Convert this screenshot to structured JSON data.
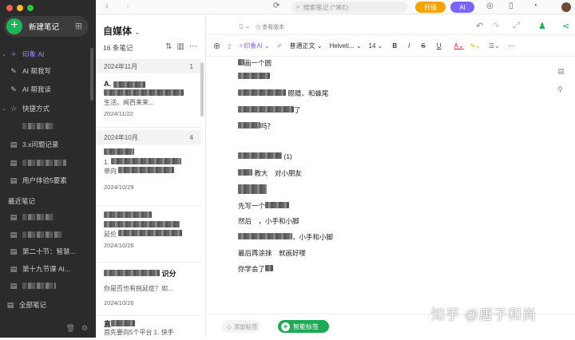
{
  "window": {
    "traffic_colors": [
      "#ff5f57",
      "#febc2e",
      "#28c840"
    ]
  },
  "sidebar": {
    "new_note": "新建笔记",
    "sections": [
      {
        "label": "印象 AI",
        "active": true
      },
      {
        "label": "AI 帮我写"
      },
      {
        "label": "AI 帮我读"
      },
      {
        "label": "快捷方式"
      },
      {
        "label": ""
      },
      {
        "label": "3.x问题记录"
      },
      {
        "label": ""
      },
      {
        "label": "用户体验5要素"
      }
    ],
    "recent_header": "最近笔记",
    "recent": [
      {
        "label": ""
      },
      {
        "label": ""
      },
      {
        "label": "第二十节：智慧..."
      },
      {
        "label": "第十九节课 AI..."
      },
      {
        "label": ""
      }
    ],
    "all_notes": "全部笔记"
  },
  "topbar": {
    "search_placeholder": "搜索笔记 (^⌘E)",
    "upgrade": "升级",
    "ai": "AI"
  },
  "list": {
    "title": "自媒体",
    "count": "16 条笔记",
    "groups": [
      {
        "month": "2024年11月",
        "count": "1"
      },
      {
        "month": "2024年10月",
        "count": "4"
      }
    ],
    "notes": [
      {
        "title": "A.",
        "snippet": "生活。闻西来来...",
        "date": "2024/11/22"
      },
      {
        "title": "",
        "snippet": "1.",
        "snippet2": "单向",
        "date": "2024/10/29"
      },
      {
        "title": "",
        "snippet": "",
        "snippet2": "延伦",
        "date": "2024/10/26"
      },
      {
        "title": "识分",
        "snippet": "你是否也有拖延症？如...",
        "date": "2024/10/26"
      },
      {
        "title": "直",
        "snippet": "首先要向5个平台 1. 快手",
        "date": ""
      }
    ]
  },
  "editor": {
    "toolbar": {
      "doc_label": "",
      "history": "查看版本",
      "ai": "印象AI",
      "style": "普通正文",
      "font": "Helveti...",
      "size": "14"
    },
    "lines": [
      "画一个圆",
      "",
      "眼睛、和蜂尾",
      "了",
      "吗？",
      "",
      "(1)",
      "教大　对小朋友",
      "",
      "先写一个",
      "然后　，小手和小脚",
      "，小手和小脚",
      "最后再涂抹　就画好喽",
      "你学会了"
    ],
    "footer": {
      "tag_placeholder": "添加标签",
      "smart_tag": "智能标签"
    }
  },
  "watermark": "知乎 @唐子和尚",
  "colors": {
    "accent_green": "#1fa855",
    "accent_purple": "#7b63ff",
    "upgrade": "#f4a300"
  }
}
